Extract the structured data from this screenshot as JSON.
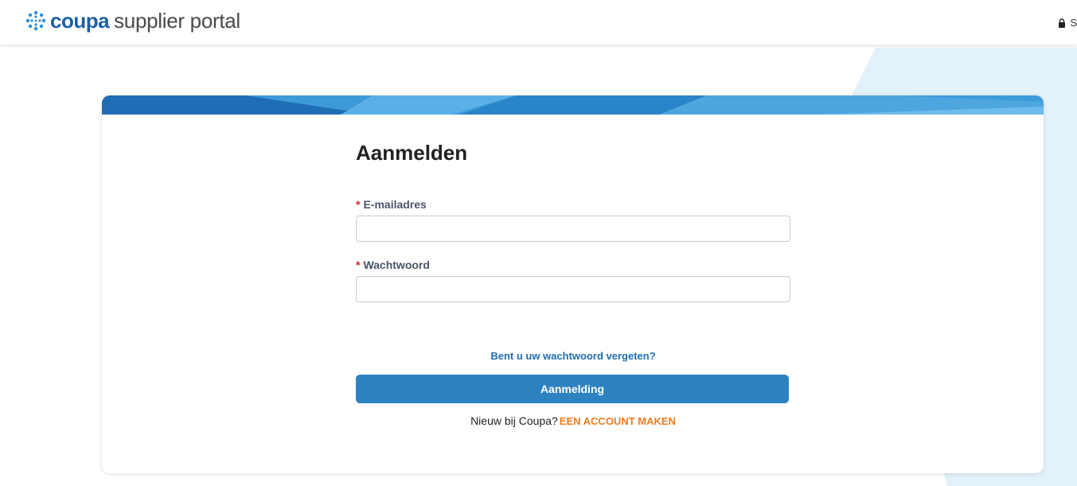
{
  "header": {
    "logo_brand": "coupa",
    "logo_product": "supplier portal",
    "right_text": "S",
    "lock_icon": "lock-icon"
  },
  "login": {
    "title": "Aanmelden",
    "required_marker": "*",
    "email_label": "E-mailadres",
    "email_value": "",
    "password_label": "Wachtwoord",
    "password_value": "",
    "forgot_link": "Bent u uw wachtwoord vergeten?",
    "submit_label": "Aanmelding",
    "new_user_text": "Nieuw bij Coupa?",
    "create_account_link": "EEN ACCOUNT MAKEN"
  },
  "colors": {
    "brand_blue": "#1d5fa8",
    "button_blue": "#2d82c2",
    "link_blue": "#1f6db5",
    "required_red": "#d0261d",
    "accent_orange": "#f07c1e",
    "background_light_blue": "#e3f1fb"
  }
}
